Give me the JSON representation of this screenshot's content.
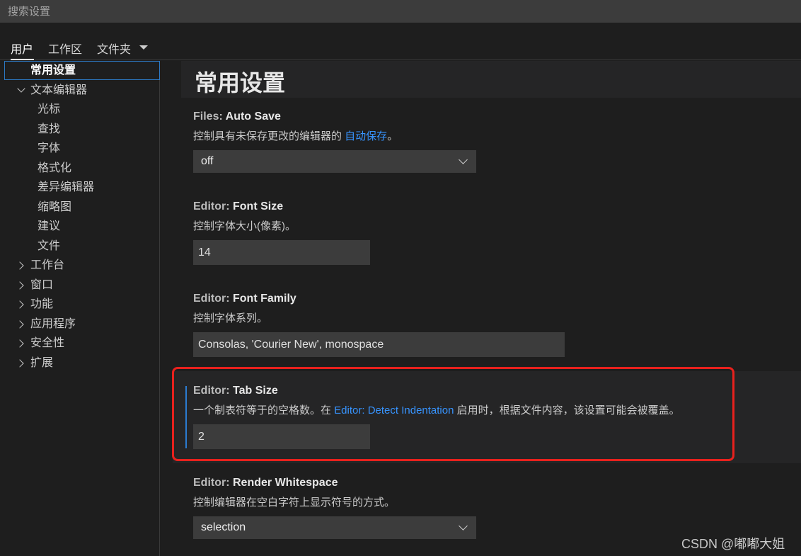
{
  "search": {
    "placeholder": "搜索设置"
  },
  "tabs": [
    {
      "label": "用户"
    },
    {
      "label": "工作区"
    },
    {
      "label": "文件夹"
    }
  ],
  "toc": {
    "common": "常用设置",
    "text_editor": "文本编辑器",
    "children": [
      "光标",
      "查找",
      "字体",
      "格式化",
      "差异编辑器",
      "缩略图",
      "建议",
      "文件"
    ],
    "groups": [
      "工作台",
      "窗口",
      "功能",
      "应用程序",
      "安全性",
      "扩展"
    ]
  },
  "main": {
    "section_title": "常用设置",
    "settings": {
      "auto_save": {
        "category": "Files: ",
        "key": "Auto Save",
        "desc_before": "控制具有未保存更改的编辑器的 ",
        "desc_link": "自动保存",
        "desc_after": "。",
        "value": "off"
      },
      "font_size": {
        "category": "Editor: ",
        "key": "Font Size",
        "desc": "控制字体大小(像素)。",
        "value": "14"
      },
      "font_family": {
        "category": "Editor: ",
        "key": "Font Family",
        "desc": "控制字体系列。",
        "value": "Consolas, 'Courier New', monospace"
      },
      "tab_size": {
        "category": "Editor: ",
        "key": "Tab Size",
        "desc_before": "一个制表符等于的空格数。在 ",
        "desc_link": "Editor: Detect Indentation",
        "desc_after": " 启用时，根据文件内容，该设置可能会被覆盖。",
        "value": "2"
      },
      "render_whitespace": {
        "category": "Editor: ",
        "key": "Render Whitespace",
        "desc": "控制编辑器在空白字符上显示符号的方式。",
        "value": "selection"
      }
    }
  },
  "watermark": "CSDN @嘟嘟大姐",
  "colors": {
    "background": "#1e1e1e",
    "input_background": "#3c3c3c",
    "link": "#3794ff",
    "focus_bar": "#2b7bd0",
    "highlight_box": "#e8211d"
  }
}
